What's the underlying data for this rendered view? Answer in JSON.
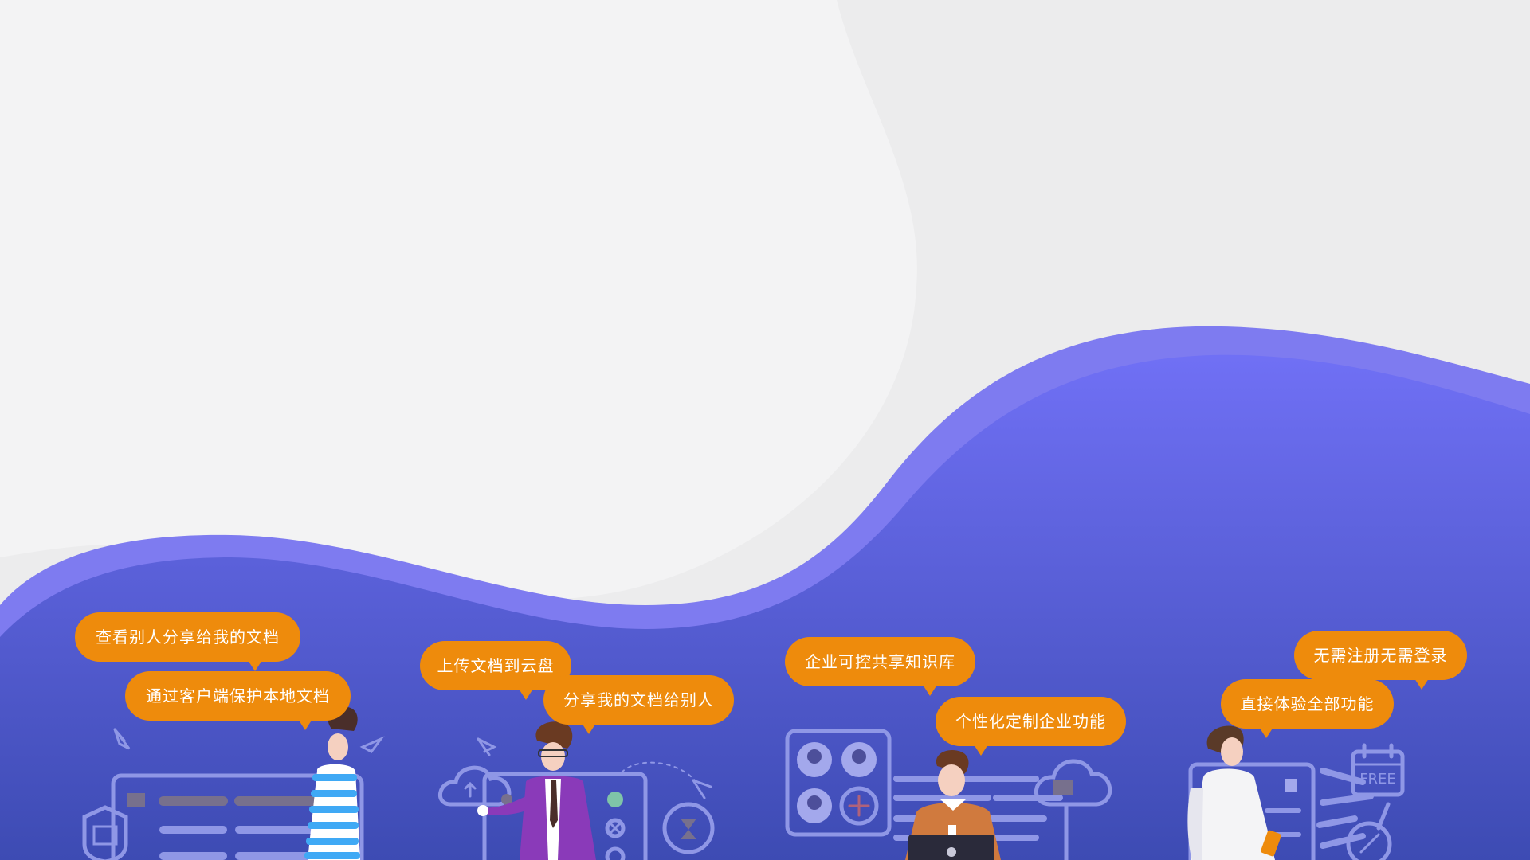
{
  "colors": {
    "background": "#f2f2f3",
    "wave_top": "#7d7af4",
    "wave_main": "#5e5eea",
    "wave_bottom": "#3f4cb8",
    "bubble": "#ee8b0c",
    "bubble_text": "#ffffff",
    "line_art": "#8f97e6"
  },
  "features": [
    {
      "bubbles": [
        "查看别人分享给我的文档",
        "通过客户端保护本地文档"
      ],
      "icons": [
        "shield-icon",
        "pc-icon",
        "folder-icon",
        "document-list-icon",
        "paper-plane-icon"
      ]
    },
    {
      "bubbles": [
        "上传文档到云盘",
        "分享我的文档给别人"
      ],
      "icons": [
        "cloud-upload-icon",
        "checklist-icon",
        "hourglass-icon",
        "paper-plane-icon"
      ]
    },
    {
      "bubbles": [
        "企业可控共享知识库",
        "个性化定制企业功能"
      ],
      "icons": [
        "team-grid-icon",
        "add-member-icon",
        "cloud-folder-icon",
        "laptop-icon"
      ]
    },
    {
      "bubbles": [
        "无需注册无需登录",
        "直接体验全部功能"
      ],
      "icons": [
        "calendar-icon",
        "free-badge-icon",
        "compass-icon",
        "phone-icon"
      ]
    }
  ]
}
